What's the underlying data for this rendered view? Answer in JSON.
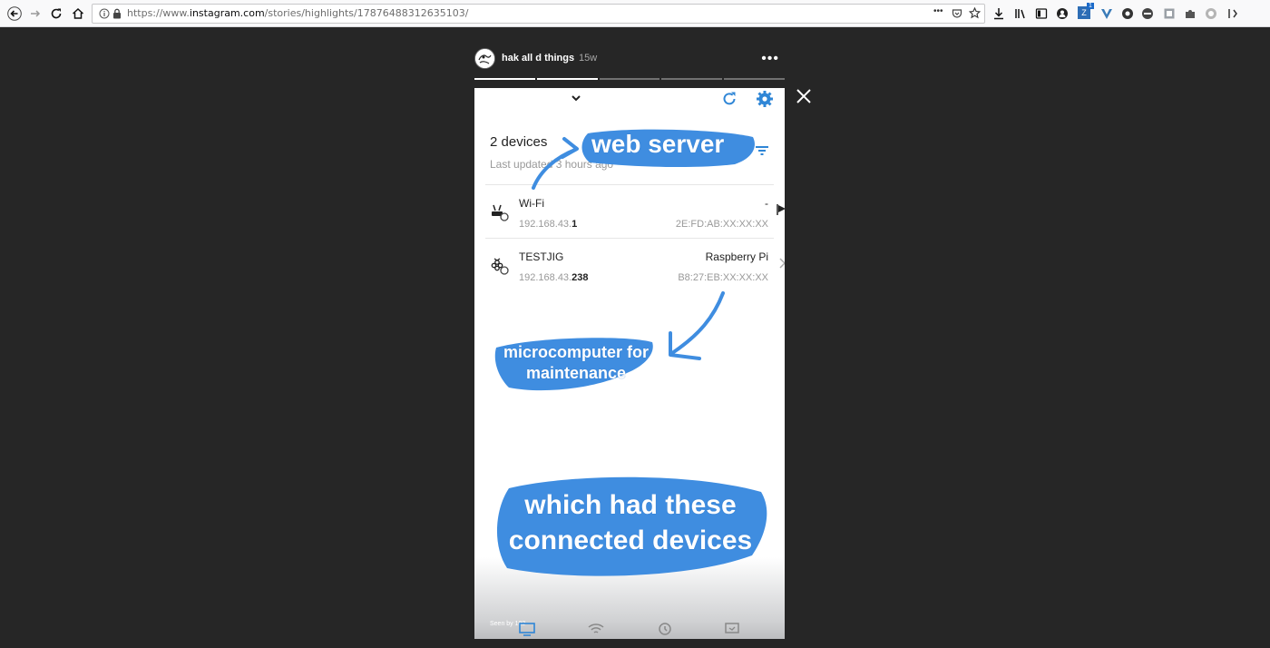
{
  "browser": {
    "url_prefix": "https://www.",
    "url_domain": "instagram.com",
    "url_path": "/stories/highlights/17876488312635103/",
    "more_dots": "•••",
    "ext_badge": "1"
  },
  "story": {
    "username": "hak all d things",
    "time_ago": "15w",
    "more": "•••",
    "segments_total": 5,
    "segments_done": 2
  },
  "app": {
    "devices_title": "2 devices",
    "last_updated": "Last updated 3 hours ago",
    "devices": [
      {
        "name": "Wi-Fi",
        "ip_prefix": "192.168.43.",
        "ip_suffix": "1",
        "type": "-",
        "mac": "2E:FD:AB:XX:XX:XX",
        "icon": "router-icon"
      },
      {
        "name": "TESTJIG",
        "ip_prefix": "192.168.43.",
        "ip_suffix": "238",
        "type": "Raspberry Pi",
        "mac": "B8:27:EB:XX:XX:XX",
        "icon": "raspberry-pi-icon"
      }
    ],
    "seen_by": "Seen by 102"
  },
  "captions": {
    "web_server": "web server",
    "micro_line1": "microcomputer for",
    "micro_line2": "maintenance",
    "which_line1": "which had these",
    "which_line2": "connected devices"
  },
  "colors": {
    "accent": "#3f8de0",
    "background": "#262626"
  }
}
